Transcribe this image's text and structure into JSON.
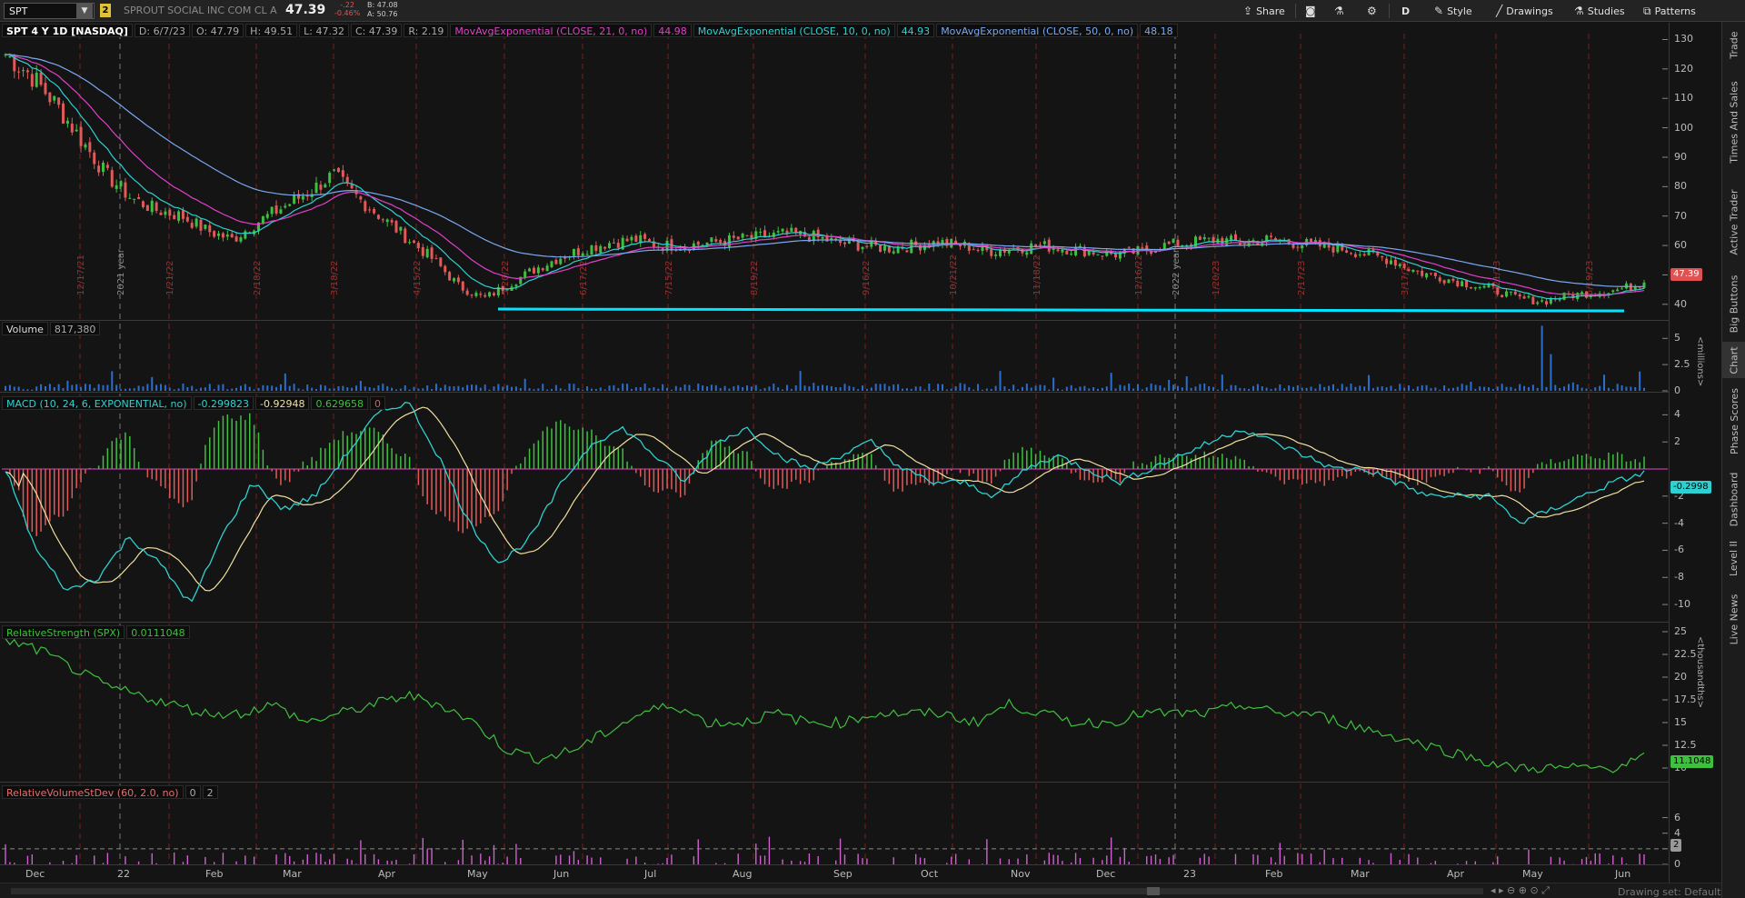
{
  "toolbar": {
    "symbol": "SPT",
    "link_badge": "2",
    "company": "SPROUT SOCIAL INC COM CL A",
    "last": "47.39",
    "change": "-.22",
    "change_pct": "-0.46%",
    "bid": "B: 47.08",
    "ask": "A: 50.76",
    "share": "Share",
    "aggregation": "D",
    "style": "Style",
    "drawings": "Drawings",
    "studies": "Studies",
    "patterns": "Patterns"
  },
  "price_pane": {
    "title": "SPT 4 Y 1D [NASDAQ]",
    "date": "D: 6/7/23",
    "open": "O: 47.79",
    "high": "H: 49.51",
    "low": "L: 47.32",
    "close": "C: 47.39",
    "range": "R: 2.19",
    "ema21_label": "MovAvgExponential (CLOSE, 21, 0, no)",
    "ema21_value": "44.98",
    "ema10_label": "MovAvgExponential (CLOSE, 10, 0, no)",
    "ema10_value": "44.93",
    "ema50_label": "MovAvgExponential (CLOSE, 50, 0, no)",
    "ema50_value": "48.18",
    "last_flag": "47.39",
    "ticks": [
      "130",
      "120",
      "110",
      "100",
      "90",
      "80",
      "70",
      "60",
      "50",
      "40"
    ]
  },
  "volume_pane": {
    "label": "Volume",
    "value": "817,380",
    "ticks": [
      "5",
      "2.5",
      "0"
    ],
    "unit": "<millions>"
  },
  "macd_pane": {
    "label": "MACD (10, 24, 6, EXPONENTIAL, no)",
    "value": "-0.299823",
    "avg": "-0.92948",
    "diff": "0.629658",
    "zero": "0",
    "flag": "-0.2998",
    "ticks": [
      "4",
      "2",
      "-2",
      "-4",
      "-6",
      "-8",
      "-10"
    ]
  },
  "rs_pane": {
    "label": "RelativeStrength (SPX)",
    "value": "0.0111048",
    "flag": "11.1048",
    "ticks": [
      "25",
      "22.5",
      "20",
      "17.5",
      "15",
      "12.5",
      "10"
    ],
    "unit": "<thousandths>"
  },
  "rvsd_pane": {
    "label": "RelativeVolumeStDev (60, 2.0, no)",
    "v1": "0",
    "v2": "2",
    "flag": "2",
    "ticks": [
      "6",
      "4",
      "2",
      "0"
    ]
  },
  "x_axis": [
    "Dec",
    "22",
    "Feb",
    "Mar",
    "Apr",
    "May",
    "Jun",
    "Jul",
    "Aug",
    "Sep",
    "Oct",
    "Nov",
    "Dec",
    "23",
    "Feb",
    "Mar",
    "Apr",
    "May",
    "Jun"
  ],
  "period_markers": [
    "12/17/21",
    "2021 year",
    "1/21/22",
    "2/18/22",
    "3/18/22",
    "4/15/22",
    "5/20/22",
    "6/17/22",
    "7/15/22",
    "8/19/22",
    "9/16/22",
    "10/21/22",
    "11/18/22",
    "12/16/22",
    "2022 year",
    "1/20/23",
    "2/17/23",
    "3/17/23",
    "4/21/23",
    "5/19/23"
  ],
  "side_tabs": [
    "Trade",
    "Times And Sales",
    "Active Trader",
    "Big Buttons",
    "Chart",
    "Phase Scores",
    "Dashboard",
    "Level II",
    "Live News"
  ],
  "drawing_set": "Drawing set: Default",
  "colors": {
    "up": "#3fbf3f",
    "down": "#e05a5a",
    "ema21": "#e040c8",
    "ema10": "#2fd0d0",
    "ema50": "#7aa8f0",
    "support": "#00e5ff",
    "rs": "#3fbf3f",
    "rvsd": "#d060d0"
  },
  "chart_data": [
    {
      "type": "candlestick",
      "title": "SPT 4 Y 1D [NASDAQ]",
      "x": [
        "Dec",
        "22",
        "Feb",
        "Mar",
        "Apr",
        "May",
        "Jun",
        "Jul",
        "Aug",
        "Sep",
        "Oct",
        "Nov",
        "Dec",
        "23",
        "Feb",
        "Mar",
        "Apr",
        "May",
        "Jun"
      ],
      "close_path": [
        125,
        118,
        108,
        96,
        84,
        76,
        72,
        70,
        65,
        62,
        68,
        73,
        78,
        84,
        76,
        69,
        62,
        55,
        46,
        42,
        47,
        52,
        56,
        59,
        61,
        62,
        60,
        60,
        61,
        62,
        63,
        64,
        63,
        61,
        60,
        59,
        60,
        61,
        60,
        58,
        59,
        60,
        59,
        58,
        57,
        58,
        60,
        61,
        62,
        61,
        62,
        61,
        60,
        59,
        57,
        55,
        51,
        49,
        47,
        45,
        42,
        41,
        43,
        44,
        45,
        47.39
      ],
      "ylim": [
        35,
        132
      ],
      "support_level": 39
    },
    {
      "type": "line",
      "title": "MACD (10, 24, 6, EXPONENTIAL, no)",
      "macd_path": [
        0,
        -6,
        -9,
        -8,
        -5,
        -7,
        -10,
        -5,
        -1,
        -3,
        -2,
        1,
        4,
        5,
        1,
        -4,
        -7,
        -5,
        -1,
        2,
        3,
        1,
        -1,
        2,
        3,
        1,
        0,
        1,
        2,
        0,
        -1,
        -1,
        -2,
        0,
        1,
        0,
        -1,
        0,
        1,
        2,
        3,
        2,
        1,
        0,
        0,
        -1,
        -2,
        -2,
        -2,
        -4,
        -3,
        -2,
        -1,
        -0.3
      ],
      "ylim": [
        -11,
        5
      ]
    },
    {
      "type": "line",
      "title": "RelativeStrength (SPX)",
      "values": [
        24,
        23,
        21,
        19,
        18,
        17,
        16,
        16,
        17,
        15,
        16,
        17,
        18,
        17,
        15,
        12,
        11,
        12,
        14,
        16,
        17,
        15,
        15,
        16,
        15,
        15,
        16,
        16,
        16,
        15,
        17,
        16,
        15,
        15,
        16,
        16,
        16,
        17,
        16,
        16,
        15,
        14,
        13,
        12,
        11,
        10,
        10,
        10,
        10,
        11.1
      ],
      "ylim": [
        9,
        25
      ]
    },
    {
      "type": "bar",
      "title": "RelativeVolumeStDev (60, 2.0, no)",
      "ylim": [
        0,
        7
      ],
      "threshold": 2
    }
  ]
}
